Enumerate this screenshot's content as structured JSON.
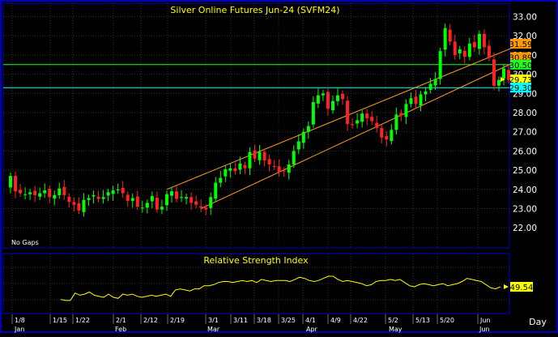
{
  "chart_data": [
    {
      "type": "candlestick",
      "title": "Silver Online Futures Jun-24 (SVFM24)",
      "ylim": [
        21.5,
        33.6
      ],
      "y_ticks": [
        22.0,
        23.0,
        24.0,
        25.0,
        26.0,
        27.0,
        28.0,
        29.0,
        30.0,
        31.0,
        32.0,
        33.0
      ],
      "x_ticks": [
        "1/8",
        "1/15",
        "1/22",
        "2/1",
        "2/12",
        "2/19",
        "3/1",
        "3/11",
        "3/18",
        "3/25",
        "4/1",
        "4/9",
        "4/22",
        "5/2",
        "5/13",
        "5/20",
        "Jun"
      ],
      "month_labels": [
        "Jan",
        "Feb",
        "Mar",
        "Apr",
        "May",
        "Jun"
      ],
      "periodicity_label": "Day",
      "annotation": "No Gaps",
      "price_labels": [
        "31.59",
        "30.89",
        "30.50",
        "29.73",
        "29.30"
      ],
      "closes": [
        24.7,
        23.9,
        23.8,
        23.75,
        23.85,
        23.7,
        23.8,
        23.95,
        23.6,
        23.7,
        24.05,
        23.7,
        23.35,
        23.2,
        22.9,
        23.45,
        23.55,
        23.7,
        23.5,
        23.6,
        23.85,
        23.95,
        24.0,
        23.8,
        23.4,
        23.55,
        23.1,
        23.05,
        23.3,
        23.65,
        22.95,
        23.1,
        23.75,
        23.9,
        23.5,
        23.6,
        23.6,
        23.3,
        23.2,
        23.05,
        22.95,
        23.6,
        24.35,
        24.6,
        25.05,
        25.1,
        24.95,
        25.35,
        25.1,
        25.95,
        25.6,
        25.95,
        25.5,
        25.3,
        25.2,
        24.9,
        24.95,
        25.3,
        26.0,
        26.5,
        27.0,
        27.3,
        28.55,
        28.9,
        29.0,
        28.2,
        28.6,
        28.9,
        28.7,
        27.4,
        27.35,
        27.6,
        27.95,
        27.7,
        27.55,
        27.2,
        26.7,
        26.6,
        27.1,
        27.9,
        27.85,
        28.45,
        28.75,
        28.45,
        28.95,
        29.1,
        29.5,
        29.75,
        31.2,
        32.4,
        31.7,
        31.0,
        31.3,
        30.9,
        31.6,
        31.4,
        32.1,
        31.4,
        30.85,
        29.4,
        29.7,
        30.3,
        29.7
      ],
      "horizontal_lines": [
        30.5,
        29.3
      ],
      "trend_channels": [
        {
          "line_a": [
            [
              32,
              24.0
            ],
            [
              103,
              31.4
            ]
          ],
          "line_b": [
            [
              39,
              23.0
            ],
            [
              103,
              30.6
            ]
          ]
        }
      ]
    },
    {
      "type": "line",
      "title": "Relative Strength Index",
      "ylim": [
        0,
        100
      ],
      "last_value_label": "49.54",
      "values": [
        38,
        37,
        37,
        44,
        42,
        43,
        45,
        42,
        41,
        40,
        43,
        40,
        39,
        43,
        42,
        43,
        41,
        40,
        41,
        42,
        41,
        42,
        43,
        41,
        47,
        48,
        47,
        46,
        48,
        48,
        51,
        51,
        52,
        54,
        55,
        55,
        54,
        55,
        56,
        55,
        56,
        54,
        57,
        56,
        55,
        56,
        56,
        56,
        55,
        57,
        59,
        58,
        56,
        55,
        56,
        58,
        60,
        60,
        57,
        55,
        56,
        55,
        54,
        53,
        51,
        52,
        55,
        56,
        56,
        57,
        56,
        57,
        54,
        51,
        50,
        52,
        53,
        52,
        51,
        52,
        53,
        51,
        52,
        53,
        55,
        58,
        57,
        56,
        55,
        52,
        49,
        48,
        50
      ]
    }
  ],
  "colors": {
    "background": "#000000",
    "frame": "#0000b8",
    "up_candle": "#00ff00",
    "down_candle": "#ff2222",
    "channel": "#ffa020",
    "support_line": "#22ff22",
    "cyan_line": "#00ffff",
    "rsi_line": "#ffff00",
    "axis_text": "#ffffff",
    "title_text": "#ffff00"
  }
}
